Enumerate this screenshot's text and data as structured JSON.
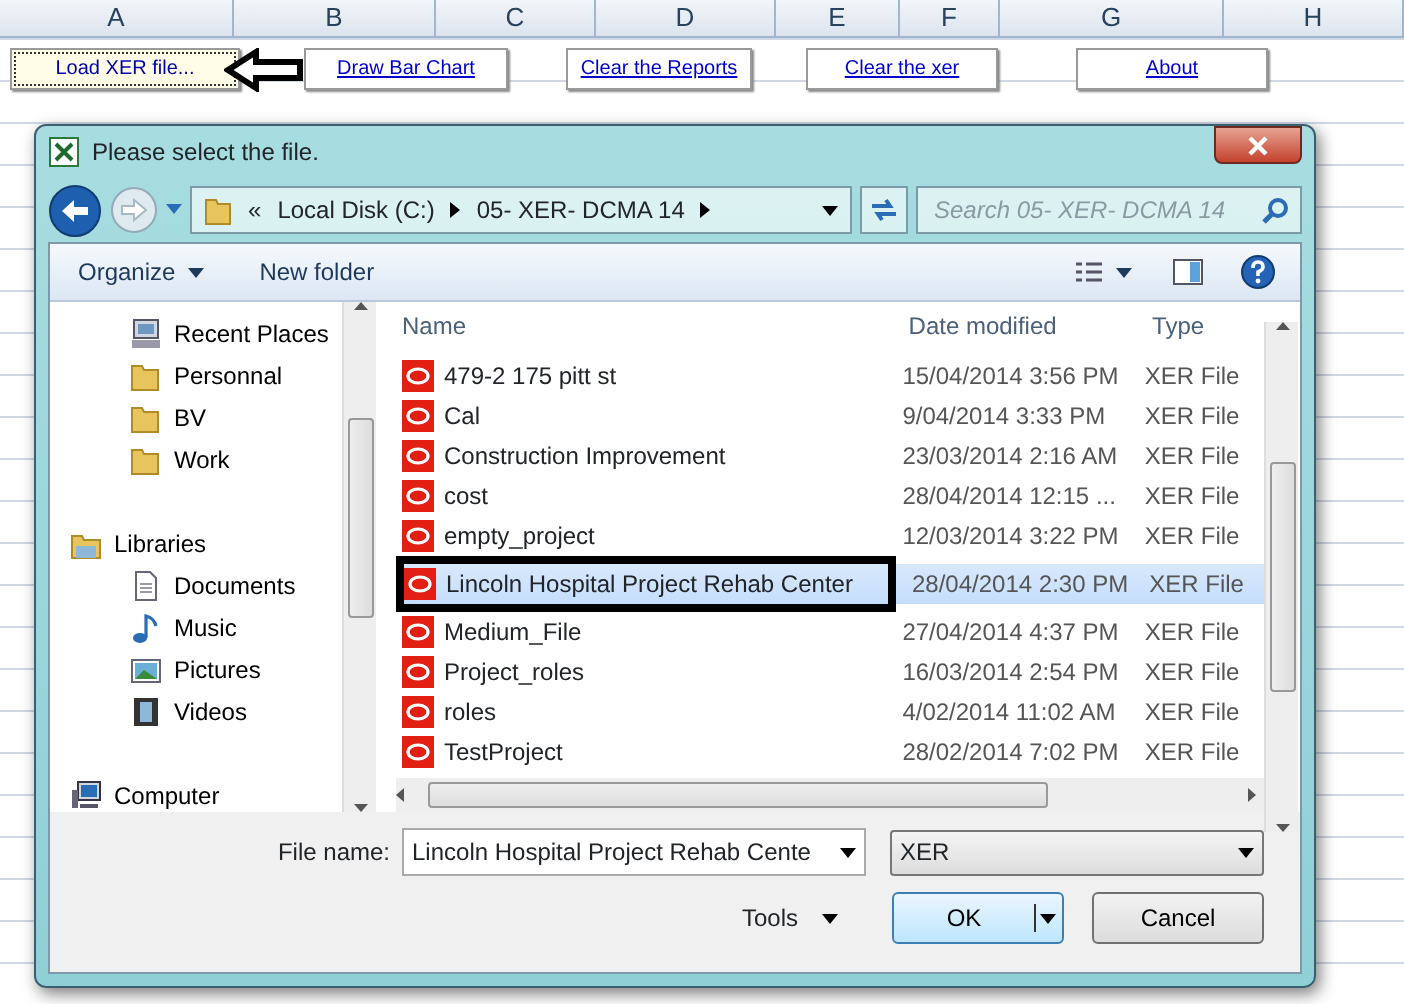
{
  "sheet": {
    "columns": [
      "A",
      "B",
      "C",
      "D",
      "E",
      "F",
      "G",
      "H"
    ]
  },
  "sheet_buttons": [
    {
      "label": "Load XER file...",
      "focused": true
    },
    {
      "label": "Draw Bar Chart",
      "focused": false
    },
    {
      "label": "Clear the Reports",
      "focused": false
    },
    {
      "label": "Clear the xer",
      "focused": false
    },
    {
      "label": "About",
      "focused": false
    }
  ],
  "dialog": {
    "title": "Please select the file.",
    "breadcrumb": [
      "«",
      "Local Disk (C:)",
      "05- XER- DCMA 14"
    ],
    "search": {
      "placeholder": "Search 05- XER- DCMA 14"
    },
    "toolbar": [
      "Organize",
      "New folder"
    ],
    "nav": [
      {
        "label": "Recent Places",
        "kind": "recent"
      },
      {
        "label": "Personnal",
        "kind": "folder"
      },
      {
        "label": "BV",
        "kind": "folder"
      },
      {
        "label": "Work",
        "kind": "folder"
      },
      {
        "label": "Libraries",
        "kind": "library",
        "children": [
          {
            "label": "Documents",
            "kind": "documents"
          },
          {
            "label": "Music",
            "kind": "music"
          },
          {
            "label": "Pictures",
            "kind": "pictures"
          },
          {
            "label": "Videos",
            "kind": "videos"
          }
        ]
      },
      {
        "label": "Computer",
        "kind": "computer"
      }
    ],
    "columns": [
      "Name",
      "Date modified",
      "Type"
    ],
    "files": [
      {
        "name": "479-2 175 pitt st",
        "date": "15/04/2014 3:56 PM",
        "type": "XER File",
        "selected": false
      },
      {
        "name": "Cal",
        "date": "9/04/2014 3:33 PM",
        "type": "XER File",
        "selected": false
      },
      {
        "name": "Construction Improvement",
        "date": "23/03/2014 2:16 AM",
        "type": "XER File",
        "selected": false
      },
      {
        "name": "cost",
        "date": "28/04/2014 12:15 ...",
        "type": "XER File",
        "selected": false
      },
      {
        "name": "empty_project",
        "date": "12/03/2014 3:22 PM",
        "type": "XER File",
        "selected": false
      },
      {
        "name": "Lincoln Hospital Project Rehab Center",
        "date": "28/04/2014 2:30 PM",
        "type": "XER File",
        "selected": true
      },
      {
        "name": "Medium_File",
        "date": "27/04/2014 4:37 PM",
        "type": "XER File",
        "selected": false
      },
      {
        "name": "Project_roles",
        "date": "16/03/2014 2:54 PM",
        "type": "XER File",
        "selected": false
      },
      {
        "name": "roles",
        "date": "4/02/2014 11:02 AM",
        "type": "XER File",
        "selected": false
      },
      {
        "name": "TestProject",
        "date": "28/02/2014 7:02 PM",
        "type": "XER File",
        "selected": false
      }
    ],
    "file_name": {
      "label": "File name:",
      "value": "Lincoln Hospital Project Rehab Cente"
    },
    "file_type": "XER",
    "tools": "Tools",
    "buttons": [
      "OK",
      "Cancel"
    ]
  }
}
